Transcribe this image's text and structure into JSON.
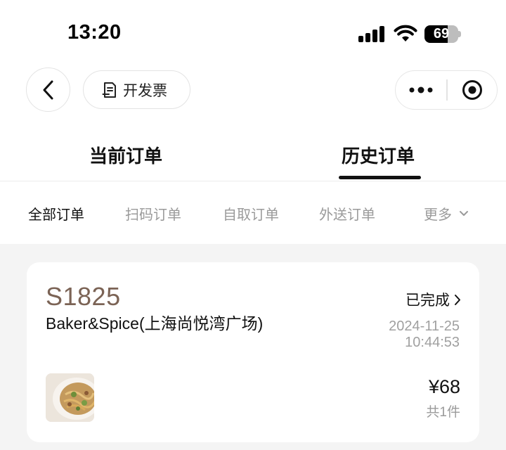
{
  "status_bar": {
    "time": "13:20",
    "battery": 69
  },
  "nav": {
    "invoice_label": "开发票"
  },
  "main_tabs": [
    {
      "label": "当前订单",
      "active": false
    },
    {
      "label": "历史订单",
      "active": true
    }
  ],
  "sub_tabs": [
    {
      "label": "全部订单",
      "active": true
    },
    {
      "label": "扫码订单",
      "active": false
    },
    {
      "label": "自取订单",
      "active": false
    },
    {
      "label": "外送订单",
      "active": false
    },
    {
      "label": "更多",
      "active": false
    }
  ],
  "order": {
    "number": "S1825",
    "store": "Baker&Spice(上海尚悦湾广场)",
    "status": "已完成",
    "date": "2024-11-25",
    "time": "10:44:53",
    "price": "¥68",
    "count": "共1件"
  },
  "colors": {
    "order_number": "#7b6355",
    "muted": "#9a9a9a",
    "background": "#f4f4f4"
  }
}
